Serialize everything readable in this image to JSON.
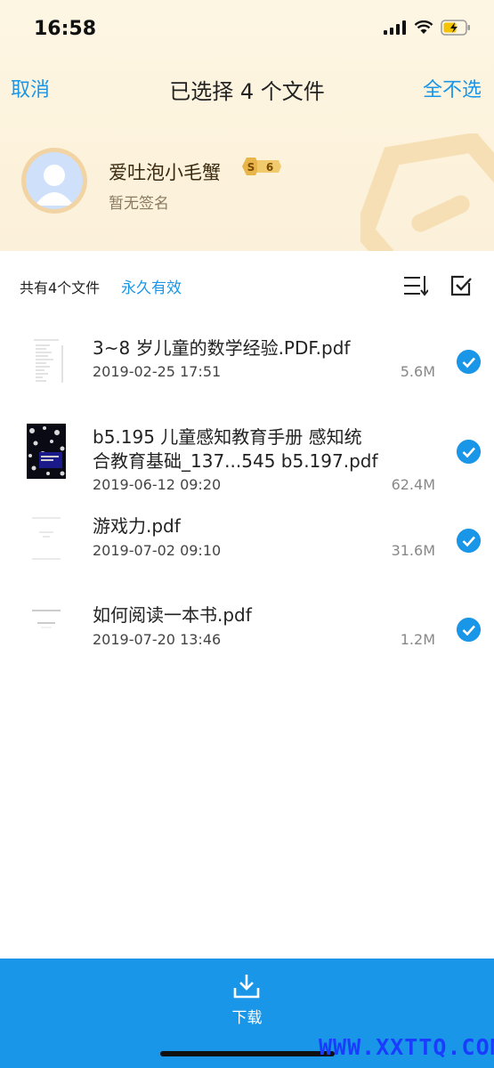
{
  "status_bar": {
    "time": "16:58"
  },
  "nav": {
    "cancel": "取消",
    "title": "已选择 4 个文件",
    "deselect_all": "全不选"
  },
  "user": {
    "name": "爱吐泡小毛蟹",
    "level": "6",
    "level_symbol": "S",
    "signature": "暂无签名"
  },
  "summary": {
    "file_count": "共有4个文件",
    "validity": "永久有效"
  },
  "files": [
    {
      "name": "3~8 岁儿童的数学经验.PDF.pdf",
      "date": "2019-02-25 17:51",
      "size": "5.6M",
      "selected": true
    },
    {
      "name_line1": "b5.195  儿童感知教育手册  感知统",
      "name_line2": "合教育基础_137...545  b5.197.pdf",
      "date": "2019-06-12 09:20",
      "size": "62.4M",
      "selected": true
    },
    {
      "name": "游戏力.pdf",
      "date": "2019-07-02 09:10",
      "size": "31.6M",
      "selected": true
    },
    {
      "name": "如何阅读一本书.pdf",
      "date": "2019-07-20 13:46",
      "size": "1.2M",
      "selected": true
    }
  ],
  "download": {
    "label": "下载"
  },
  "watermark": "WWW.XXTTQ.COM",
  "colors": {
    "accent": "#1a96e8",
    "hero_bg": "#fdf6e3",
    "badge_gold": "#e8b54a"
  }
}
